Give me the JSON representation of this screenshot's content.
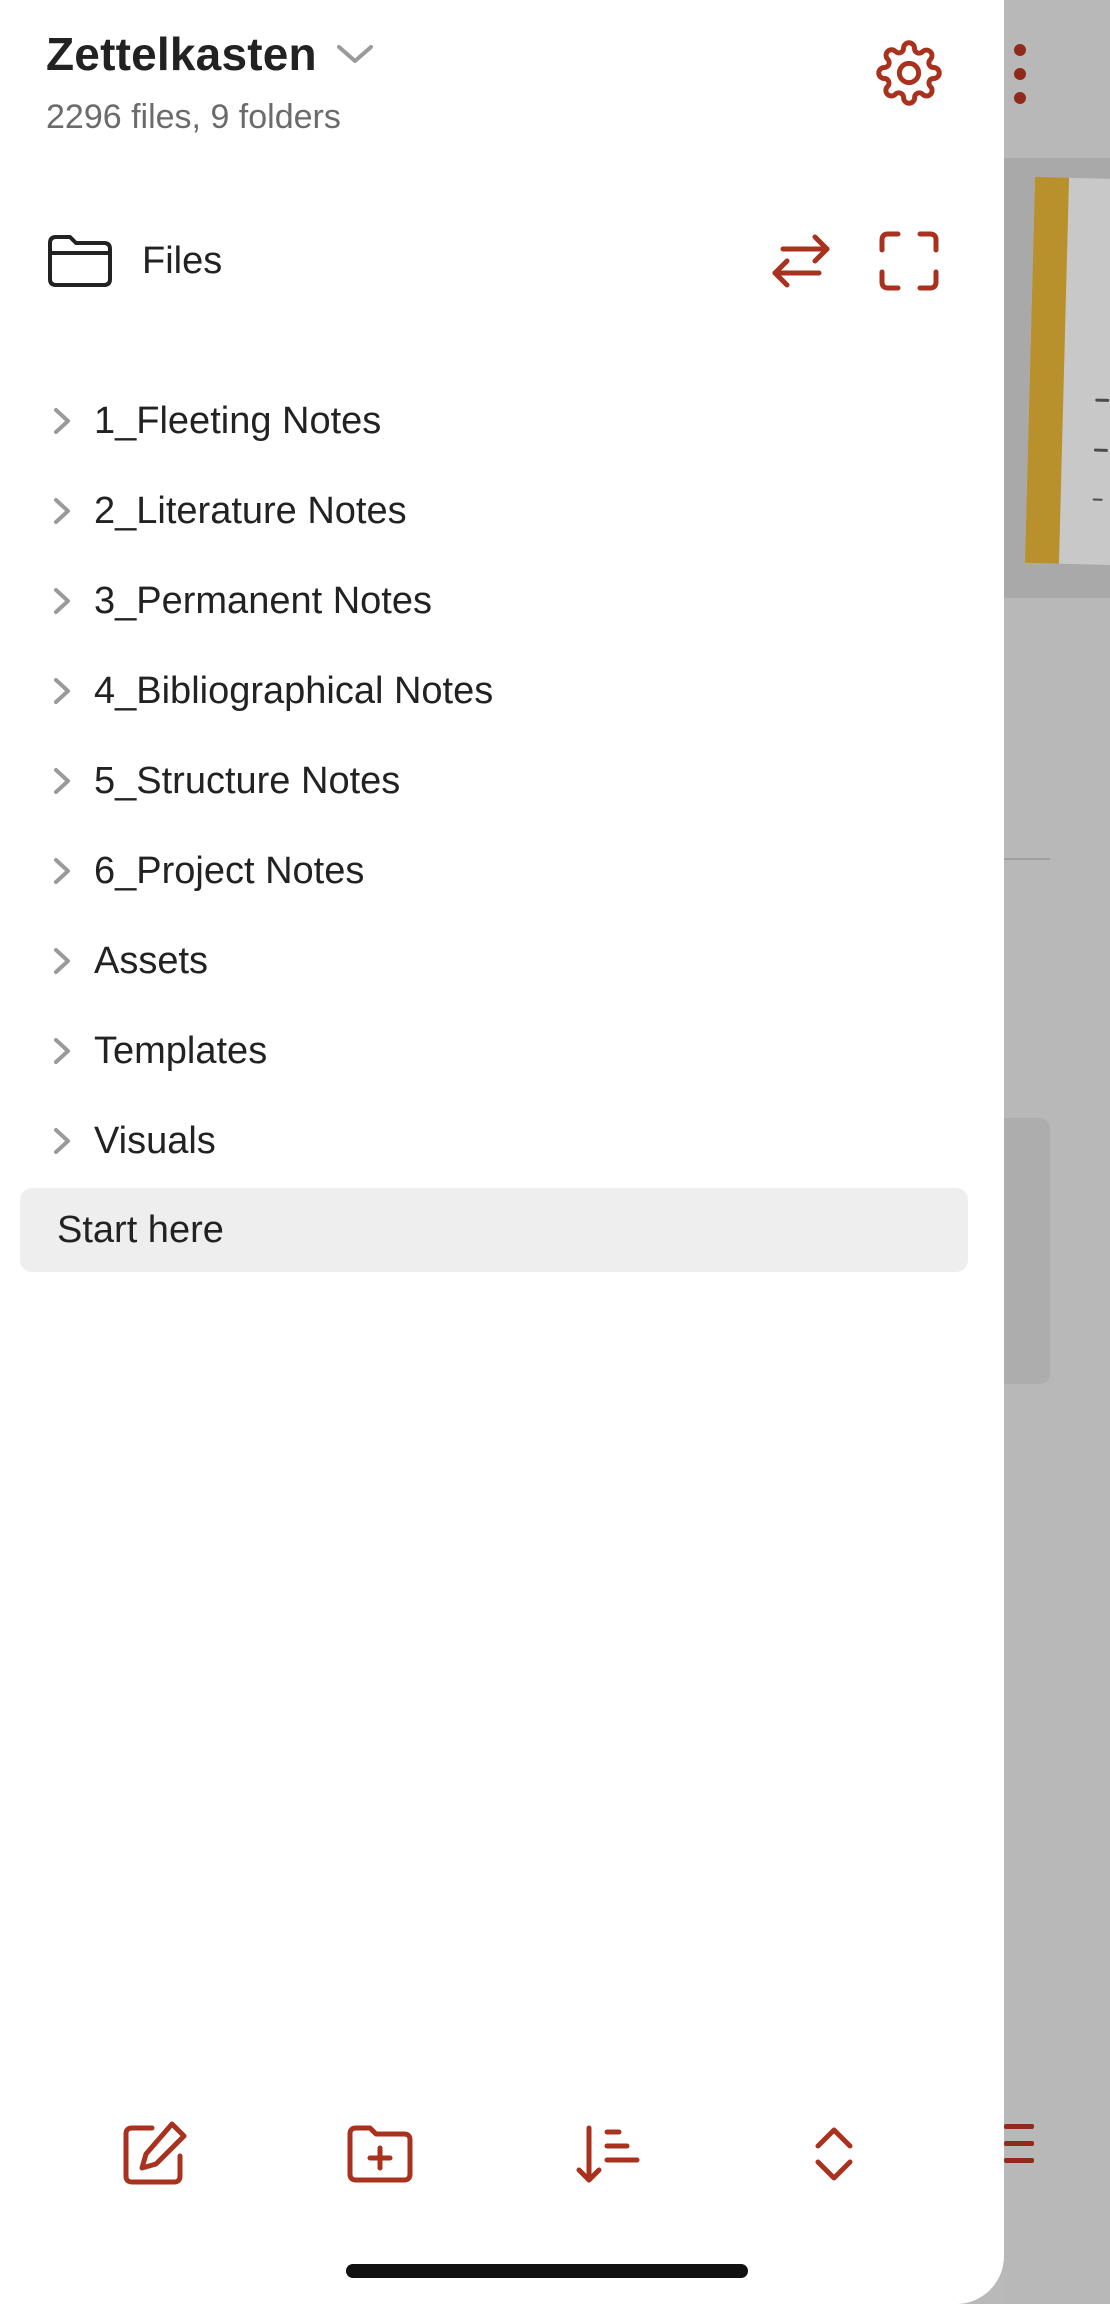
{
  "vault": {
    "name": "Zettelkasten",
    "stats": "2296 files, 9 folders"
  },
  "section": {
    "label": "Files"
  },
  "tree": {
    "folders": [
      "1_Fleeting Notes",
      "2_Literature Notes",
      "3_Permanent Notes",
      "4_Bibliographical Notes",
      "5_Structure Notes",
      "6_Project Notes",
      "Assets",
      "Templates",
      "Visuals"
    ],
    "files": [
      "Start here"
    ]
  },
  "icons": {
    "settings": "gear-icon",
    "section": "folder-icon",
    "swap": "swap-arrows-icon",
    "expand": "fullscreen-corners-icon",
    "folder_chevron": "chevron-right-icon",
    "new_note": "edit-square-icon",
    "new_folder": "folder-plus-icon",
    "sort": "sort-lines-icon",
    "collapse": "chevron-up-down-icon"
  },
  "colors": {
    "accent": "#a8321e",
    "text": "#222222",
    "muted": "#6b6b6b",
    "selected_bg": "#eeeeee"
  }
}
